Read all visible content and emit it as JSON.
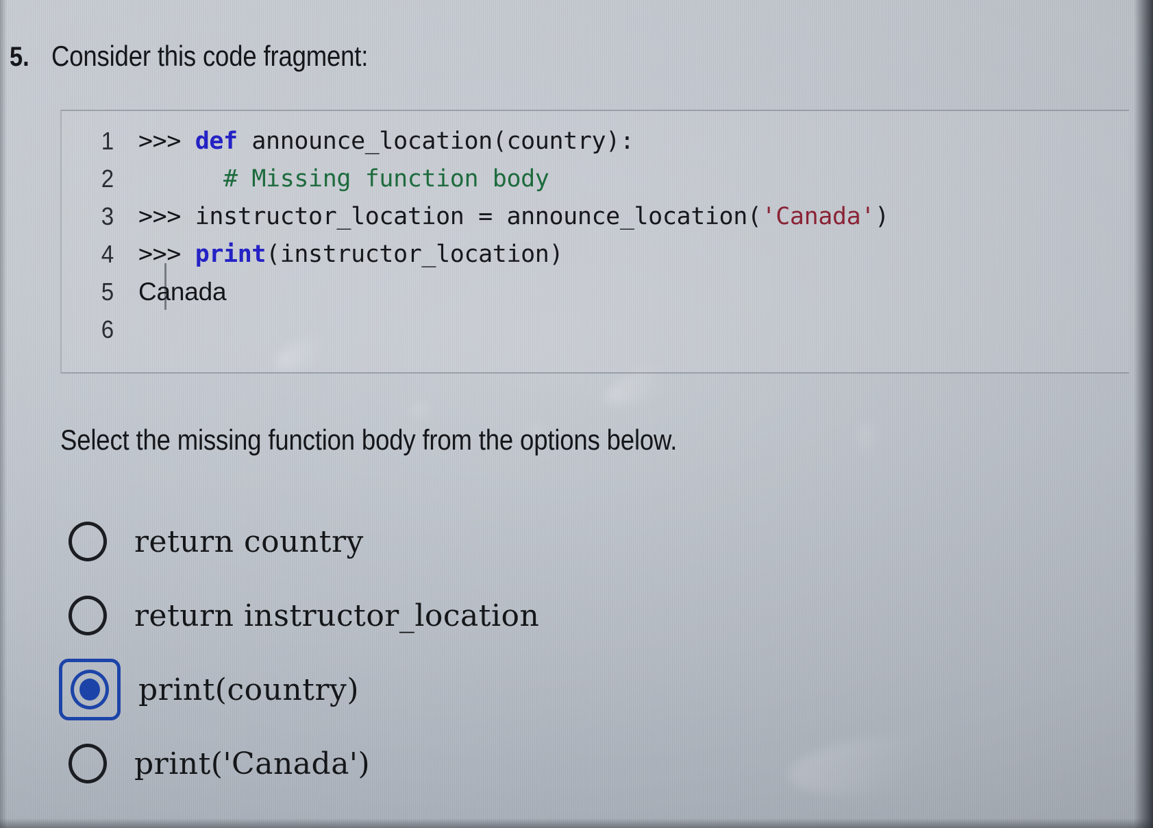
{
  "question": {
    "number": "5.",
    "prompt": "Consider this code fragment:"
  },
  "code_block": {
    "lines": [
      {
        "number": "1",
        "segments": [
          {
            "text": ">>> ",
            "style": "prompt"
          },
          {
            "text": "def",
            "style": "kw"
          },
          {
            "text": " announce_location(country):",
            "style": "plain"
          }
        ]
      },
      {
        "number": "2",
        "segments": [
          {
            "text": "      # Missing function body",
            "style": "comment"
          }
        ]
      },
      {
        "number": "3",
        "segments": [
          {
            "text": ">>> ",
            "style": "prompt"
          },
          {
            "text": "instructor_location = announce_location(",
            "style": "plain"
          },
          {
            "text": "'Canada'",
            "style": "str"
          },
          {
            "text": ")",
            "style": "plain"
          }
        ]
      },
      {
        "number": "4",
        "segments": [
          {
            "text": ">>> ",
            "style": "prompt"
          },
          {
            "text": "print",
            "style": "builtin"
          },
          {
            "text": "(instructor_location)",
            "style": "plain"
          }
        ]
      },
      {
        "number": "5",
        "segments": [
          {
            "text": "Canada",
            "style": "output"
          }
        ]
      },
      {
        "number": "6",
        "segments": []
      }
    ]
  },
  "instruction": "Select the missing function body from the options below.",
  "options": [
    {
      "label": "return country",
      "selected": false
    },
    {
      "label": "return instructor_location",
      "selected": false
    },
    {
      "label": "print(country)",
      "selected": true
    },
    {
      "label": "print('Canada')",
      "selected": false
    }
  ],
  "colors": {
    "keyword": "#2422c4",
    "comment": "#1d6b3d",
    "string": "#8a2436",
    "selection_blue": "#1c44a8",
    "text": "#14161a",
    "screen_background": "#bcc2ca"
  }
}
